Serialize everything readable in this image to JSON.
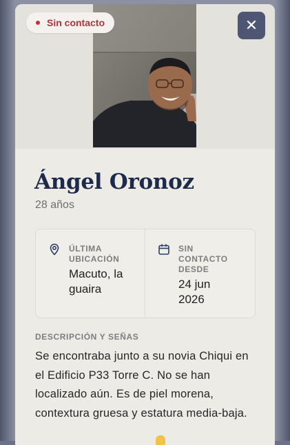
{
  "status_badge": {
    "label": "Sin contacto",
    "color": "#c0303a"
  },
  "close_button": {
    "icon": "close-icon",
    "glyph": "✕"
  },
  "person": {
    "name": "Ángel Oronoz",
    "age": "28 años"
  },
  "info": {
    "last_location": {
      "icon": "location-pin-icon",
      "label_line1": "ÚLTIMA",
      "label_line2": "UBICACIÓN",
      "value_line1": "Macuto, la",
      "value_line2": "guaira"
    },
    "no_contact_since": {
      "icon": "calendar-icon",
      "label_line1": "SIN",
      "label_line2": "CONTACTO",
      "label_line3": "DESDE",
      "value_line1": "24 jun",
      "value_line2": "2026"
    }
  },
  "description": {
    "label": "DESCRIPCIÓN Y SEÑAS",
    "text": "Se encontraba junto a su novia Chiqui en el Edificio P33 Torre C. No se han localizado aún. Es de piel morena, contextura gruesa y estatura media-baja."
  },
  "colors": {
    "accent": "#1d2a4a",
    "status_red": "#b2323a",
    "close_bg": "#4f5673"
  }
}
